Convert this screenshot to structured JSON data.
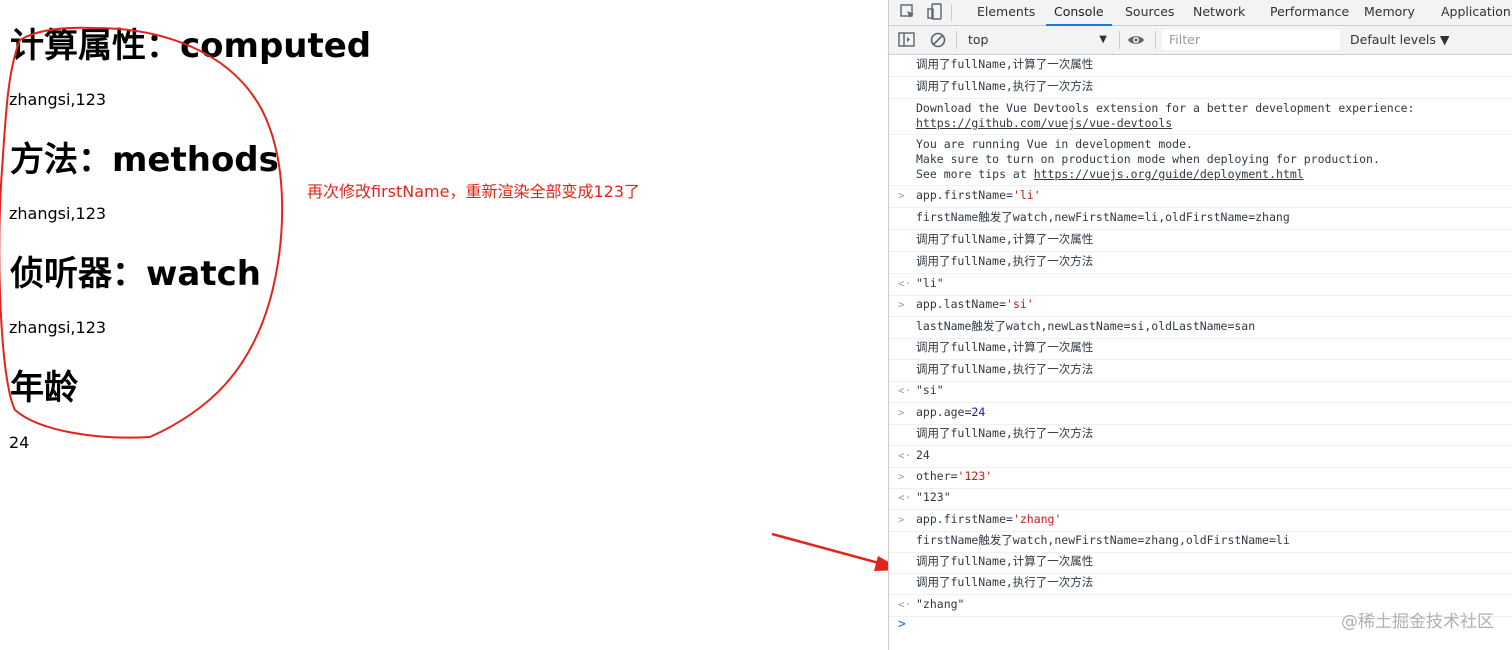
{
  "page": {
    "computed_heading": "计算属性：computed",
    "computed_value": "zhangsi,123",
    "methods_heading": "方法：methods",
    "methods_value": "zhangsi,123",
    "watch_heading": "侦听器：watch",
    "watch_value": "zhangsi,123",
    "age_heading": "年龄",
    "age_value": "24"
  },
  "annotation": {
    "text": "再次修改firstName，重新渲染全部变成123了",
    "color": "#e3241b"
  },
  "devtools": {
    "tabs": [
      "Elements",
      "Console",
      "Sources",
      "Network",
      "Performance",
      "Memory",
      "Application"
    ],
    "active_tab": "Console",
    "context": "top",
    "filter_placeholder": "Filter",
    "levels": "Default levels ▼",
    "rows": [
      {
        "gut": "",
        "text": "调用了fullName,计算了一次属性"
      },
      {
        "gut": "",
        "text": "调用了fullName,执行了一次方法"
      },
      {
        "gut": "",
        "text": "Download the Vue Devtools extension for a better development experience:",
        "link": "https://github.com/vuejs/vue-devtools"
      },
      {
        "gut": "",
        "text": "You are running Vue in development mode.",
        "text2": "Make sure to turn on production mode when deploying for production.",
        "text3": "See more tips at ",
        "link": "https://vuejs.org/guide/deployment.html"
      },
      {
        "gut": ">",
        "text": "app.firstName=",
        "str": "'li'"
      },
      {
        "gut": "",
        "text": "firstName触发了watch,newFirstName=li,oldFirstName=zhang"
      },
      {
        "gut": "",
        "text": "调用了fullName,计算了一次属性"
      },
      {
        "gut": "",
        "text": "调用了fullName,执行了一次方法"
      },
      {
        "gut": "<·",
        "ret": "\"li\""
      },
      {
        "gut": ">",
        "text": "app.lastName=",
        "str": "'si'"
      },
      {
        "gut": "",
        "text": "lastName触发了watch,newLastName=si,oldLastName=san"
      },
      {
        "gut": "",
        "text": "调用了fullName,计算了一次属性"
      },
      {
        "gut": "",
        "text": "调用了fullName,执行了一次方法"
      },
      {
        "gut": "<·",
        "ret": "\"si\""
      },
      {
        "gut": ">",
        "text": "app.age=",
        "num": "24"
      },
      {
        "gut": "",
        "text": "调用了fullName,执行了一次方法"
      },
      {
        "gut": "<·",
        "num": "24"
      },
      {
        "gut": ">",
        "text": "other=",
        "str": "'123'"
      },
      {
        "gut": "<·",
        "ret": "\"123\""
      },
      {
        "gut": ">",
        "text": "app.firstName=",
        "str": "'zhang'"
      },
      {
        "gut": "",
        "text": "firstName触发了watch,newFirstName=zhang,oldFirstName=li"
      },
      {
        "gut": "",
        "text": "调用了fullName,计算了一次属性"
      },
      {
        "gut": "",
        "text": "调用了fullName,执行了一次方法"
      },
      {
        "gut": "<·",
        "ret": "\"zhang\""
      }
    ],
    "prompt_symbol": ">"
  },
  "watermark": "@稀土掘金技术社区"
}
